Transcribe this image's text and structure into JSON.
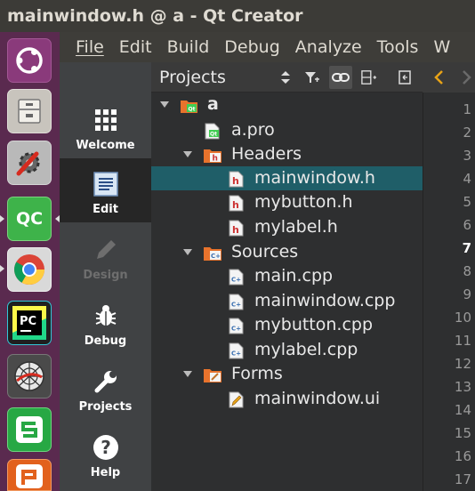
{
  "window": {
    "title": "mainwindow.h @ a - Qt Creator"
  },
  "launcher": {
    "items": [
      {
        "name": "ubuntu-dash",
        "label": ""
      },
      {
        "name": "file-cabinet",
        "label": ""
      },
      {
        "name": "system-settings",
        "label": ""
      },
      {
        "name": "qt-creator",
        "label": "QC"
      },
      {
        "name": "chrome",
        "label": ""
      },
      {
        "name": "pycharm",
        "label": "PC"
      },
      {
        "name": "web-app",
        "label": ""
      },
      {
        "name": "wps-spreadsheets",
        "label": ""
      },
      {
        "name": "wps-presentation",
        "label": ""
      }
    ]
  },
  "menu": {
    "items": [
      "File",
      "Edit",
      "Build",
      "Debug",
      "Analyze",
      "Tools",
      "W"
    ]
  },
  "modes": [
    {
      "label": "Welcome",
      "state": "normal"
    },
    {
      "label": "Edit",
      "state": "active"
    },
    {
      "label": "Design",
      "state": "disabled"
    },
    {
      "label": "Debug",
      "state": "normal"
    },
    {
      "label": "Projects",
      "state": "normal"
    },
    {
      "label": "Help",
      "state": "normal"
    }
  ],
  "projects_panel": {
    "title": "Projects",
    "tree": [
      {
        "label": "a",
        "depth": 0,
        "icon": "project-folder-icon",
        "expanded": true
      },
      {
        "label": "a.pro",
        "depth": 1,
        "icon": "pro-file-icon"
      },
      {
        "label": "Headers",
        "depth": 1,
        "icon": "headers-folder-icon",
        "expanded": true
      },
      {
        "label": "mainwindow.h",
        "depth": 2,
        "icon": "header-file-icon",
        "selected": true
      },
      {
        "label": "mybutton.h",
        "depth": 2,
        "icon": "header-file-icon"
      },
      {
        "label": "mylabel.h",
        "depth": 2,
        "icon": "header-file-icon"
      },
      {
        "label": "Sources",
        "depth": 1,
        "icon": "sources-folder-icon",
        "expanded": true
      },
      {
        "label": "main.cpp",
        "depth": 2,
        "icon": "cpp-file-icon"
      },
      {
        "label": "mainwindow.cpp",
        "depth": 2,
        "icon": "cpp-file-icon"
      },
      {
        "label": "mybutton.cpp",
        "depth": 2,
        "icon": "cpp-file-icon"
      },
      {
        "label": "mylabel.cpp",
        "depth": 2,
        "icon": "cpp-file-icon"
      },
      {
        "label": "Forms",
        "depth": 1,
        "icon": "forms-folder-icon",
        "expanded": true
      },
      {
        "label": "mainwindow.ui",
        "depth": 2,
        "icon": "ui-file-icon"
      }
    ]
  },
  "editor": {
    "line_numbers": [
      "1",
      "2",
      "3",
      "4",
      "5",
      "6",
      "7",
      "8",
      "9",
      "10",
      "11",
      "12",
      "13",
      "14",
      "15",
      "16",
      "17"
    ],
    "current_line": "7"
  },
  "colors": {
    "selection": "#1f5e68",
    "launcher": "#5a2a4f",
    "accent_arrow": "#e8a317"
  }
}
